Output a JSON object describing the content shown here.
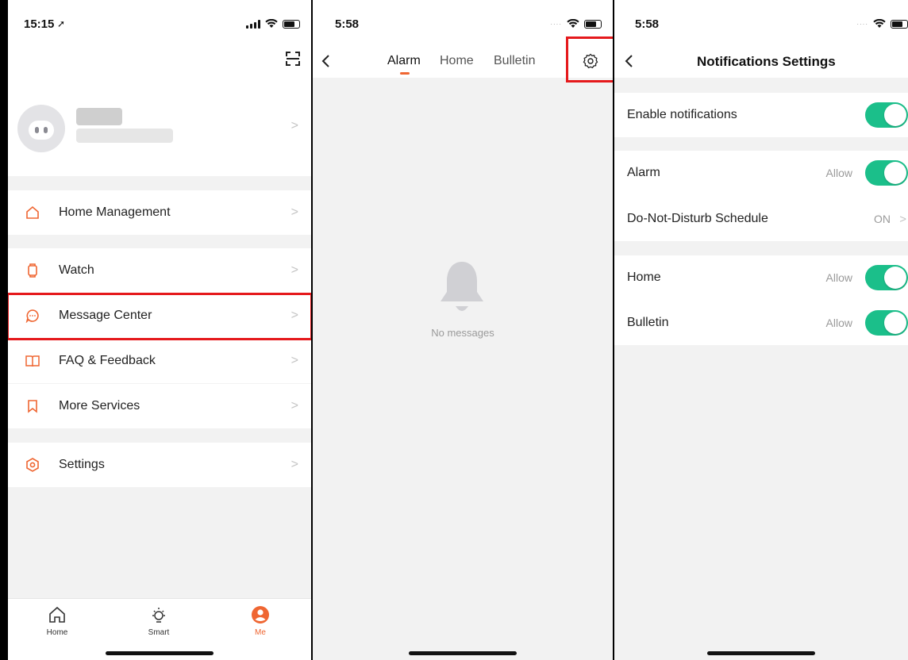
{
  "screen1": {
    "status_time": "15:15",
    "menu": [
      {
        "label": "Home Management"
      },
      {
        "label": "Watch"
      },
      {
        "label": "Message Center"
      },
      {
        "label": "FAQ & Feedback"
      },
      {
        "label": "More Services"
      },
      {
        "label": "Settings"
      }
    ],
    "tabs": [
      {
        "label": "Home"
      },
      {
        "label": "Smart"
      },
      {
        "label": "Me"
      }
    ],
    "chevron": ">"
  },
  "screen2": {
    "status_time": "5:58",
    "tabs": [
      "Alarm",
      "Home",
      "Bulletin"
    ],
    "active_tab": "Alarm",
    "empty_text": "No messages"
  },
  "screen3": {
    "status_time": "5:58",
    "title": "Notifications Settings",
    "enable_label": "Enable notifications",
    "rows": [
      {
        "label": "Alarm",
        "value": "Allow",
        "on": true
      },
      {
        "label": "Do-Not-Disturb Schedule",
        "value": "ON"
      },
      {
        "label": "Home",
        "value": "Allow",
        "on": true
      },
      {
        "label": "Bulletin",
        "value": "Allow",
        "on": true
      }
    ]
  },
  "colors": {
    "accent": "#ef6632",
    "toggle_on": "#1bbf8a",
    "highlight": "#e5191c"
  }
}
